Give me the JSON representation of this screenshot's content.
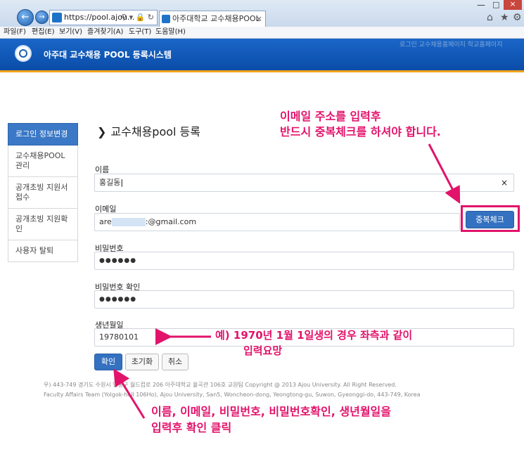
{
  "browser": {
    "address": "https://pool.ajou...",
    "tab_title": "아주대학교 교수채용POOL",
    "menus": [
      "파일(F)",
      "편집(E)",
      "보기(V)",
      "즐겨찾기(A)",
      "도구(T)",
      "도움말(H)"
    ]
  },
  "header": {
    "title": "아주대 교수채용 POOL 등록시스템",
    "right_links": "로그인 교수채용홈페이지 학교홈페이지"
  },
  "sidebar": {
    "items": [
      {
        "label": "로그인 정보변경"
      },
      {
        "label": "교수채용POOL관리"
      },
      {
        "label": "공개초빙 지원서 접수"
      },
      {
        "label": "공개초빙 지원확인"
      },
      {
        "label": "사용자 탈퇴"
      }
    ]
  },
  "page": {
    "title": "교수채용pool 등록"
  },
  "form": {
    "name_label": "이름",
    "name_value": "홍길동",
    "email_label": "이메일",
    "email_value_prefix": "are",
    "email_value_suffix": ":@gmail.com",
    "dup_check_label": "중복체크",
    "password_label": "비밀번호",
    "password_value": "●●●●●●",
    "password_confirm_label": "비밀번호 확인",
    "password_confirm_value": "●●●●●●",
    "birth_label": "생년월일",
    "birth_value": "19780101",
    "confirm_label": "확인",
    "reset_label": "초기화",
    "cancel_label": "취소"
  },
  "footer": {
    "line1": "우) 443-749 경기도 수원시 영통구 월드컵로 206 아주대학교 율곡관 106호 교원팀 Copyright @ 2013 Ajou University. All Right Reserved.",
    "line2": "Faculty Affairs Team (Yolgok-hall 106Ho), Ajou University, San5, Woncheon-dong, Yeongtong-gu, Suwon, Gyeonggi-do, 443-749, Korea"
  },
  "annotations": {
    "email_line1": "이메일 주소를 입력후",
    "email_line2": "반드시 중복체크를 하셔야 합니다.",
    "birth_line1": "예) 1970년 1월 1일생의 경우 좌측과 같이",
    "birth_line2": "입력요망",
    "confirm_line1": "이름, 이메일, 비밀번호, 비밀번호확인, 생년월일을",
    "confirm_line2": "입력후 확인 클릭"
  },
  "colors": {
    "header_blue": "#0a4da8",
    "accent_orange": "#f2a21b",
    "annotation_pink": "#e2136b",
    "button_blue": "#3471c0"
  }
}
